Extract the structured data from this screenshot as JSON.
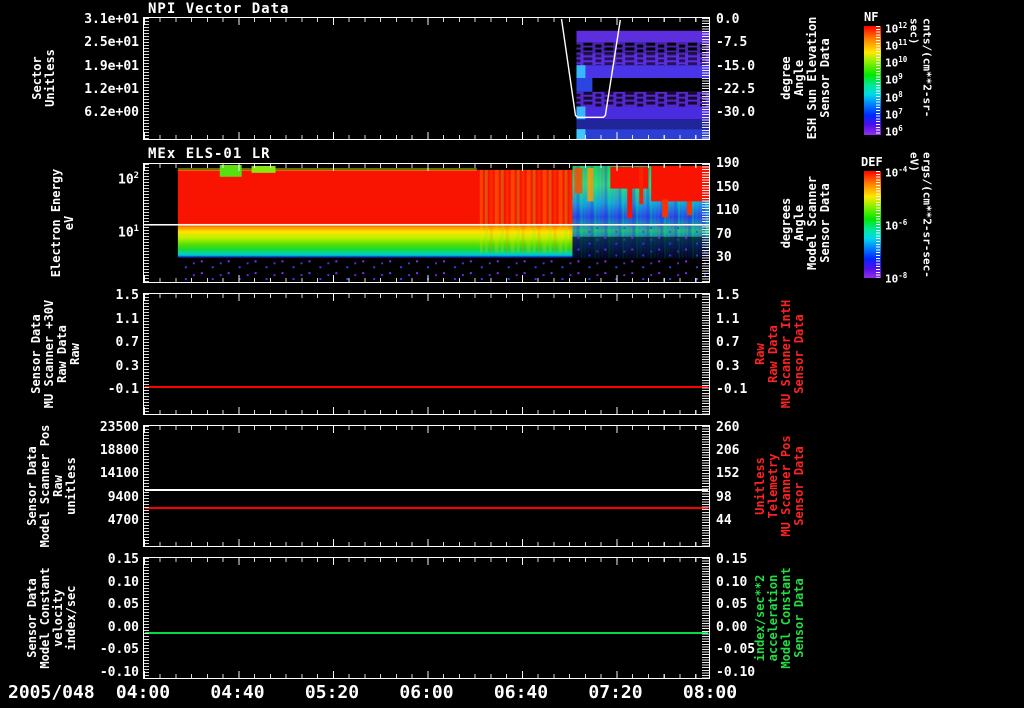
{
  "figure": {
    "date_label": "2005/048",
    "x_tick_labels": [
      "04:00",
      "04:40",
      "05:20",
      "06:00",
      "06:40",
      "07:20",
      "08:00"
    ],
    "colors": {
      "background": "#000000",
      "axis": "#ffffff",
      "red_series": "#ff0000",
      "white_series": "#ffffff",
      "green_series": "#00dd44",
      "red_label": "#ff2222",
      "green_label": "#22dd44"
    }
  },
  "panels": [
    {
      "title": "NPI Vector Data",
      "left_label_lines": [
        "Sector",
        "Unitless"
      ],
      "left_ticks": [
        "3.1e+01",
        "2.5e+01",
        "1.9e+01",
        "1.2e+01",
        "6.2e+00"
      ],
      "right_label_lines": [
        "Sensor Data",
        "ESH Sun Elevation",
        "Angle",
        "degree"
      ],
      "right_ticks": [
        "0.0",
        "-7.5",
        "-15.0",
        "-22.5",
        "-30.0"
      ]
    },
    {
      "title": "MEx ELS-01 LR",
      "left_label_lines": [
        "Electron Energy",
        "eV"
      ],
      "left_ticks_exp": [
        {
          "mant": "10",
          "exp": "2"
        },
        {
          "mant": "10",
          "exp": "1"
        }
      ],
      "right_label_lines": [
        "Sensor Data",
        "Model Scanner",
        "Angle",
        "degrees"
      ],
      "right_ticks": [
        "190",
        "150",
        "110",
        "70",
        "30"
      ]
    },
    {
      "left_label_lines": [
        "Sensor Data",
        "MU Scanner +30V",
        "Raw Data",
        "Raw"
      ],
      "left_ticks": [
        "1.5",
        "1.1",
        "0.7",
        "0.3",
        "-0.1"
      ],
      "right_label_lines": [
        "Sensor Data",
        "MU Scanner IntH",
        "Raw Data",
        "Raw"
      ],
      "right_ticks": [
        "1.5",
        "1.1",
        "0.7",
        "0.3",
        "-0.1"
      ]
    },
    {
      "left_label_lines": [
        "Sensor Data",
        "Model Scanner Pos",
        "Raw",
        "unitless"
      ],
      "left_ticks": [
        "23500",
        "18800",
        "14100",
        "9400",
        "4700"
      ],
      "right_label_lines": [
        "Sensor Data",
        "MU Scanner Pos",
        "Telemetry",
        "Unitless"
      ],
      "right_ticks": [
        "260",
        "206",
        "152",
        "98",
        "44"
      ]
    },
    {
      "left_label_lines": [
        "Sensor Data",
        "Model Constant",
        "velocity",
        "index/sec"
      ],
      "left_ticks": [
        "0.15",
        "0.10",
        "0.05",
        "0.00",
        "-0.05",
        "-0.10"
      ],
      "right_label_lines": [
        "Sensor Data",
        "Model Constant",
        "acceleration",
        "index/sec**2"
      ],
      "right_ticks": [
        "0.15",
        "0.10",
        "0.05",
        "0.00",
        "-0.05",
        "-0.10"
      ]
    }
  ],
  "colorbars": [
    {
      "name": "NF",
      "unit": "cnts/(cm**2-sr-sec)",
      "ticks": [
        {
          "mant": "10",
          "exp": "12"
        },
        {
          "mant": "10",
          "exp": "11"
        },
        {
          "mant": "10",
          "exp": "10"
        },
        {
          "mant": "10",
          "exp": "9"
        },
        {
          "mant": "10",
          "exp": "8"
        },
        {
          "mant": "10",
          "exp": "7"
        },
        {
          "mant": "10",
          "exp": "6"
        }
      ]
    },
    {
      "name": "DEF",
      "unit": "ergs/(cm**2-sr-sec-eV)",
      "ticks": [
        {
          "mant": "10",
          "exp": "-4"
        },
        {
          "mant": "10",
          "exp": "-6"
        },
        {
          "mant": "10",
          "exp": "-8"
        }
      ]
    }
  ],
  "chart_data": [
    {
      "type": "heatmap",
      "title": "NPI Vector Data",
      "ylabel": "Sector Unitless",
      "yticks": [
        "3.1e+01",
        "2.5e+01",
        "1.9e+01",
        "1.2e+01",
        "6.2e+00"
      ],
      "y2label": "Sensor Data ESH Sun Elevation Angle degree",
      "y2ticks": [
        0.0,
        -7.5,
        -15.0,
        -22.5,
        -30.0
      ],
      "colorbar": {
        "name": "NF",
        "unit": "cnts/(cm**2-sr-sec)",
        "range": [
          "1e6",
          "1e12"
        ],
        "scale": "log"
      },
      "x_range": [
        "2005/048 04:00",
        "2005/048 08:00"
      ],
      "description": "No data before ~06:55. From ~06:55 to 08:00 horizontal purple/blue sector bands with black gaps; brighter cyan-blue pixels at the leading (left) edge of the data block. Overlaid white sun-elevation curve drops from top (0 deg) at ~06:40 to a flat minimum (~ -28 deg) between ~06:55 and ~07:15, then rises back to 0 deg."
    },
    {
      "type": "heatmap",
      "title": "MEx ELS-01 LR",
      "ylabel": "Electron Energy eV",
      "yticks": [
        "1e2",
        "1e1"
      ],
      "y2label": "Sensor Data Model Scanner Angle degrees",
      "y2ticks": [
        190,
        150,
        110,
        70,
        30
      ],
      "colorbar": {
        "name": "DEF",
        "unit": "ergs/(cm**2-sr-sec-eV)",
        "range": [
          "1e-8",
          "1e-4"
        ],
        "scale": "log"
      },
      "x_range": [
        "2005/048 04:00",
        "2005/048 08:00"
      ],
      "description": "Data begins ~04:15. Intense solid red band from ~8 eV to >100 eV until ~06:20, with green/yellow blobs above it near 04:50 and 05:10. After ~06:20 the band breaks into vertical yellow/green streaks, then green/cyan/blue striations; red patches return near the top (>100 eV) after ~07:20. Below the red band: yellow-to-green layer from ~4-10 eV ending in a cyan edge; sparse purple/blue dots below ~4 eV on black. A horizontal white line crosses the full panel at ~13 eV."
    },
    {
      "type": "line",
      "title": "Sensor Data MU Scanner +30V Raw Data Raw",
      "y2label": "Sensor Data MU Scanner IntH Raw Data Raw",
      "yticks": [
        1.5,
        1.1,
        0.7,
        0.3,
        -0.1
      ],
      "series": [
        {
          "name": "MU Scanner +30V Raw",
          "color": "#ff0000",
          "shape": "constant",
          "value": 0.0
        }
      ]
    },
    {
      "type": "line",
      "title": "Sensor Data Model Scanner Pos Raw unitless",
      "y2label": "Sensor Data MU Scanner Pos Telemetry Unitless",
      "yticks": [
        23500,
        18800,
        14100,
        9400,
        4700
      ],
      "y2ticks": [
        260,
        206,
        152,
        98,
        44
      ],
      "series": [
        {
          "name": "Model Scanner Pos Raw",
          "color": "#ffffff",
          "shape": "constant",
          "value": 11900
        },
        {
          "name": "MU Scanner Pos Telemetry",
          "color": "#ff0000",
          "shape": "constant",
          "value": 8400,
          "value_right_axis": 90
        }
      ]
    },
    {
      "type": "line",
      "title": "Sensor Data Model Constant velocity index/sec",
      "y2label": "Sensor Data Model Constant acceleration index/sec**2",
      "yticks": [
        0.15,
        0.1,
        0.05,
        0.0,
        -0.05,
        -0.1
      ],
      "series": [
        {
          "name": "Model Constant velocity",
          "color": "#00dd44",
          "shape": "constant",
          "value": 0.0
        }
      ]
    }
  ]
}
